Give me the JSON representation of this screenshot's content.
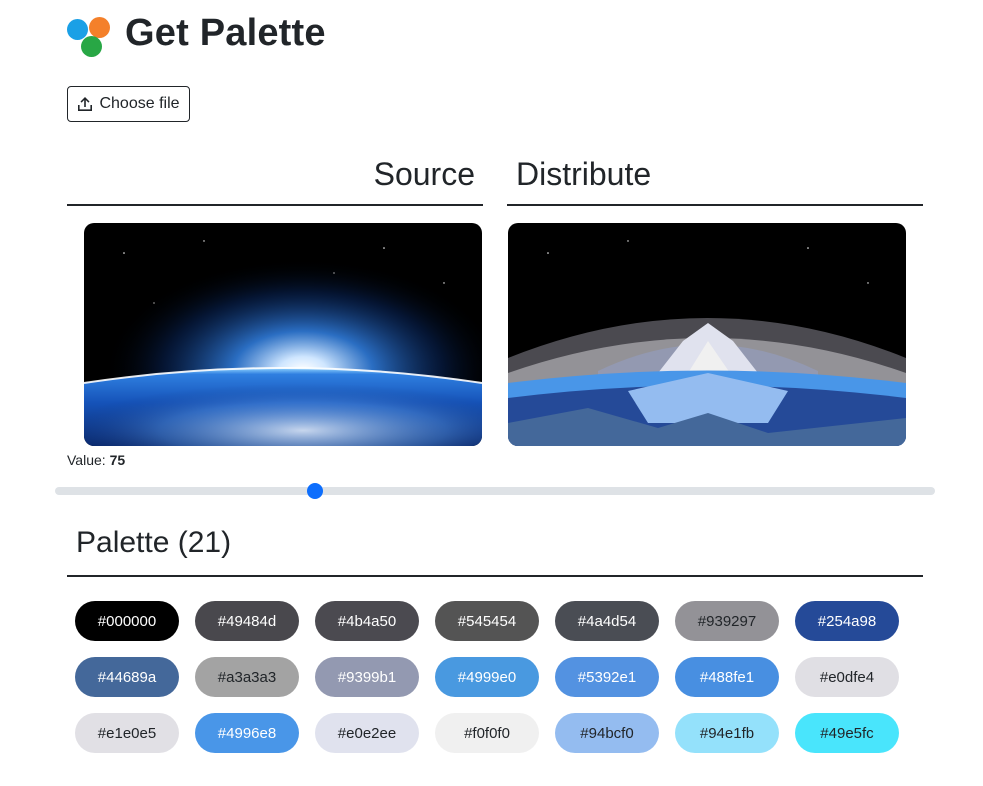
{
  "app": {
    "title": "Get Palette",
    "logo_icon": "palette-circles-icon"
  },
  "upload": {
    "label": "Choose file",
    "icon": "upload-icon"
  },
  "headings": {
    "source": "Source",
    "distribute": "Distribute"
  },
  "slider": {
    "label": "Value:",
    "value": "75",
    "fraction": 0.295
  },
  "palette": {
    "title": "Palette (21)",
    "colors": [
      {
        "hex": "#000000",
        "text": "#ffffff"
      },
      {
        "hex": "#49484d",
        "text": "#ffffff"
      },
      {
        "hex": "#4b4a50",
        "text": "#ffffff"
      },
      {
        "hex": "#545454",
        "text": "#ffffff"
      },
      {
        "hex": "#4a4d54",
        "text": "#ffffff"
      },
      {
        "hex": "#939297",
        "text": "#212529"
      },
      {
        "hex": "#254a98",
        "text": "#ffffff"
      },
      {
        "hex": "#44689a",
        "text": "#ffffff"
      },
      {
        "hex": "#a3a3a3",
        "text": "#212529"
      },
      {
        "hex": "#9399b1",
        "text": "#ffffff"
      },
      {
        "hex": "#4999e0",
        "text": "#ffffff"
      },
      {
        "hex": "#5392e1",
        "text": "#ffffff"
      },
      {
        "hex": "#488fe1",
        "text": "#ffffff"
      },
      {
        "hex": "#e0dfe4",
        "text": "#212529"
      },
      {
        "hex": "#e1e0e5",
        "text": "#212529"
      },
      {
        "hex": "#4996e8",
        "text": "#ffffff"
      },
      {
        "hex": "#e0e2ee",
        "text": "#212529"
      },
      {
        "hex": "#f0f0f0",
        "text": "#212529"
      },
      {
        "hex": "#94bcf0",
        "text": "#212529"
      },
      {
        "hex": "#94e1fb",
        "text": "#212529"
      },
      {
        "hex": "#49e5fc",
        "text": "#212529"
      }
    ]
  }
}
